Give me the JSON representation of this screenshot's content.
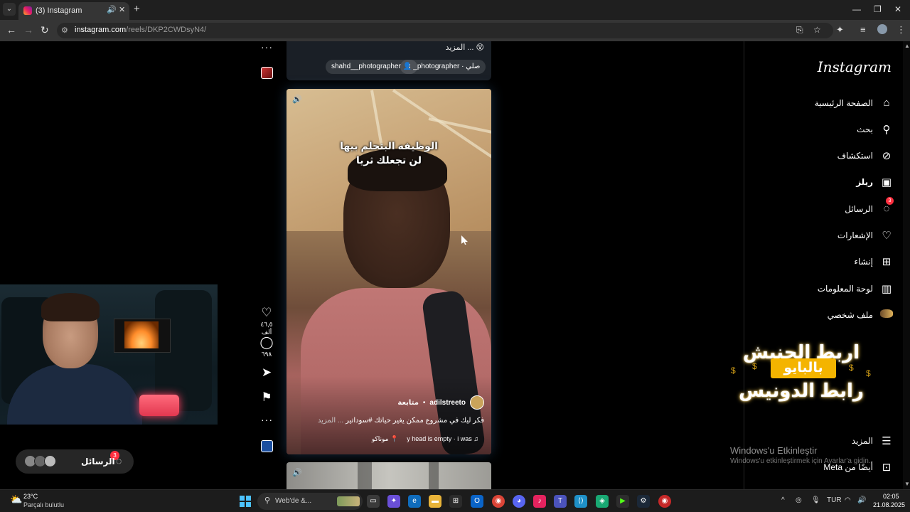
{
  "browser": {
    "tab_title": "(3) Instagram",
    "url_host": "instagram.com",
    "url_path": "/reels/DKP2CWDsyN4/"
  },
  "prev_reel": {
    "caption_more": "😵 ... المزيد",
    "chip_user": "shahd__photographer",
    "chip_audio": "_photographer · صلي"
  },
  "reel": {
    "overlay_line1": "الوظيفه البتحلم بيها",
    "overlay_line2": "لن تجعلك ثريا",
    "username": "adilstreeto",
    "follow_label": "متابعة",
    "dot": "•",
    "caption": "فكر ليك في مشروع ممكن يغير حياتك #سوداتير",
    "caption_more": "... المزيد",
    "audio": "y head is empty · i was",
    "location": "موناكو"
  },
  "actions": {
    "likes": "٤٦,٥ ألف",
    "comments": "٦٩٨"
  },
  "sidebar": {
    "logo": "Instagram",
    "items": [
      {
        "label": "الصفحة الرئيسية",
        "icon": "home-icon"
      },
      {
        "label": "بحث",
        "icon": "search-icon"
      },
      {
        "label": "استكشاف",
        "icon": "compass-icon"
      },
      {
        "label": "ريلز",
        "icon": "reels-icon"
      },
      {
        "label": "الرسائل",
        "icon": "messenger-icon",
        "badge": "3"
      },
      {
        "label": "الإشعارات",
        "icon": "heart-icon"
      },
      {
        "label": "إنشاء",
        "icon": "plus-square-icon"
      },
      {
        "label": "لوحة المعلومات",
        "icon": "dashboard-icon"
      },
      {
        "label": "ملف شخصي",
        "icon": "avatar-icon"
      },
      {
        "label": "المزيد",
        "icon": "menu-icon"
      },
      {
        "label": "أيضًا من Meta",
        "icon": "apps-icon"
      }
    ]
  },
  "promo": {
    "line1": "اربط الحنيش",
    "line2": "بالبايو",
    "line3": "رابط الدونيس"
  },
  "activation": {
    "title": "Windows'u Etkinleştir",
    "subtitle": "Windows'u etkinleştirmek için Ayarlar'a gidin."
  },
  "messages_pill": {
    "label": "الرسائل",
    "badge": "3"
  },
  "taskbar": {
    "temp": "23°C",
    "weather": "Parçalı bulutlu",
    "search_placeholder": "Web'de &...",
    "lang": "TUR",
    "time": "02:05",
    "date": "21.08.2025"
  }
}
